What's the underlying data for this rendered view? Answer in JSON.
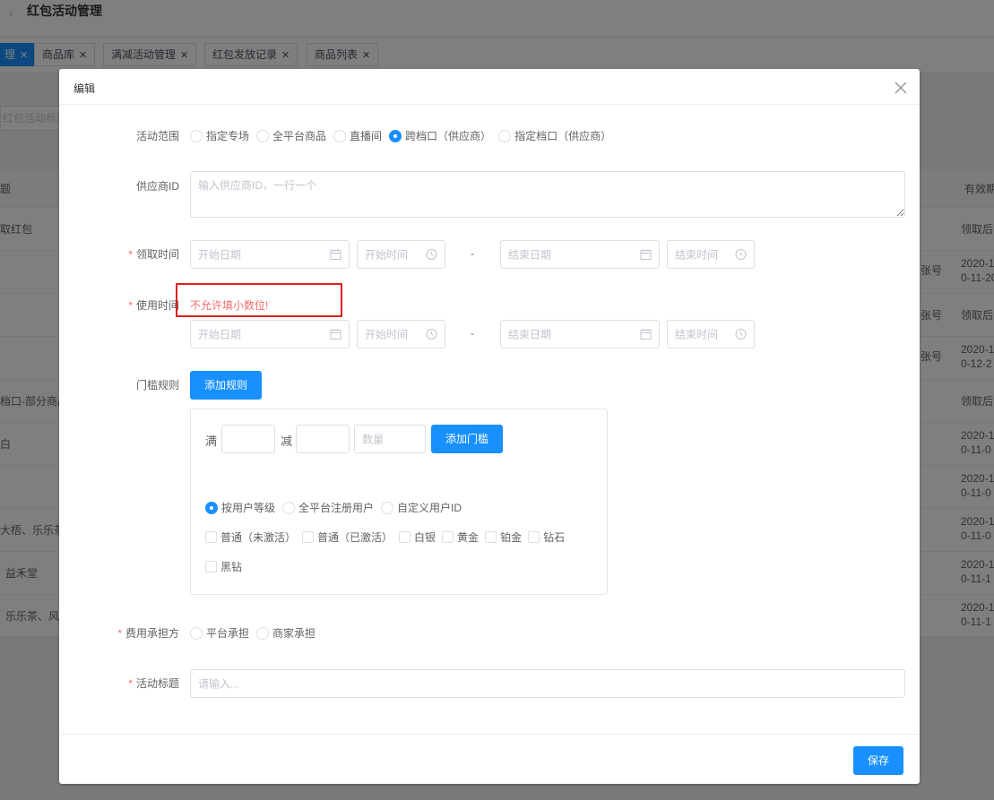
{
  "background": {
    "page_title": "红包活动管理",
    "tabs": [
      {
        "label": "理",
        "active": true
      },
      {
        "label": "商品库",
        "active": false
      },
      {
        "label": "满减活动管理",
        "active": false
      },
      {
        "label": "红包发放记录",
        "active": false
      },
      {
        "label": "商品列表",
        "active": false
      }
    ],
    "search_placeholder": "红包活动标题",
    "table_header_left": "题",
    "table_header_right": "有效期",
    "rows": [
      {
        "left": "取红包",
        "mid": "",
        "right": "领取后"
      },
      {
        "left": "",
        "mid": "张号",
        "right": "2020-1",
        "right2": "0-11-20"
      },
      {
        "left": "",
        "mid": "张号",
        "right": "领取后"
      },
      {
        "left": "",
        "mid": "张号",
        "right": "2020-1",
        "right2": "0-12-2"
      },
      {
        "left": "档口-部分商品",
        "mid": "",
        "right": "领取后"
      },
      {
        "left": "白",
        "mid": "",
        "right": "2020-1",
        "right2": "0-11-0"
      },
      {
        "left": "",
        "mid": "",
        "right": "2020-1",
        "right2": "0-11-0"
      },
      {
        "left": "大梧、乐乐茶",
        "mid": "",
        "right": "2020-1",
        "right2": "0-11-0"
      },
      {
        "left": "益禾堂",
        "mid": "",
        "right": "2020-1",
        "right2": "0-11-1"
      },
      {
        "left": "乐乐茶、风",
        "mid": "",
        "right": "2020-1",
        "right2": "0-11-1"
      }
    ]
  },
  "dialog": {
    "title": "编辑",
    "save_label": "保存",
    "scope": {
      "label": "活动范围",
      "options": [
        "指定专场",
        "全平台商品",
        "直播间",
        "跨档口（供应商）",
        "指定档口（供应商）"
      ],
      "selected": 3
    },
    "supplier": {
      "label": "供应商ID",
      "placeholder": "输入供应商ID，一行一个"
    },
    "receive_time": {
      "label": "领取时间",
      "start_date": "开始日期",
      "start_time": "开始时间",
      "separator": "-",
      "end_date": "结束日期",
      "end_time": "结束时间"
    },
    "use_time": {
      "label": "使用时间",
      "error": "不允许填小数位!",
      "start_date": "开始日期",
      "start_time": "开始时间",
      "separator": "-",
      "end_date": "结束日期",
      "end_time": "结束时间"
    },
    "threshold": {
      "label": "门槛规则",
      "add_rule_label": "添加规则",
      "full_label": "满",
      "minus_label": "减",
      "qty_placeholder": "数量",
      "add_threshold_label": "添加门槛",
      "user_options": [
        "按用户等级",
        "全平台注册用户",
        "自定义用户ID"
      ],
      "user_selected": 0,
      "levels": [
        "普通（未激活）",
        "普通（已激活）",
        "白银",
        "黄金",
        "铂金",
        "钻石",
        "黑钻"
      ]
    },
    "cost": {
      "label": "费用承担方",
      "options": [
        "平台承担",
        "商家承担"
      ]
    },
    "activity_title": {
      "label": "活动标题",
      "placeholder": "请输入..."
    }
  },
  "colors": {
    "primary": "#1890ff",
    "error": "#f56c6c",
    "highlight_box": "#e02020"
  }
}
